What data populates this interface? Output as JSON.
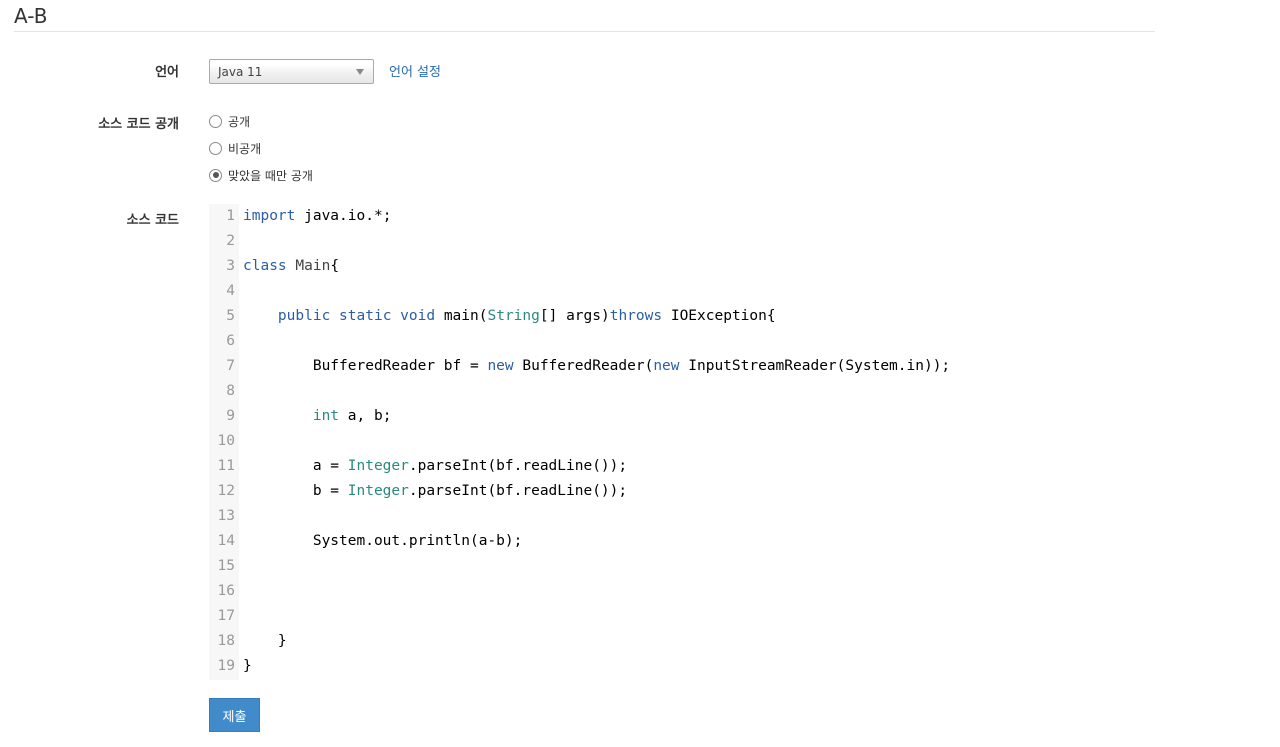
{
  "page": {
    "title": "A-B"
  },
  "language": {
    "label": "언어",
    "selected": "Java 11",
    "settings_link": "언어 설정"
  },
  "visibility": {
    "label": "소스 코드 공개",
    "options": [
      {
        "label": "공개",
        "checked": false
      },
      {
        "label": "비공개",
        "checked": false
      },
      {
        "label": "맞았을 때만 공개",
        "checked": true
      }
    ]
  },
  "source": {
    "label": "소스 코드",
    "lines": [
      [
        {
          "t": "import",
          "c": "kw"
        },
        {
          "t": " java.io.*;"
        }
      ],
      [],
      [
        {
          "t": "class",
          "c": "kw"
        },
        {
          "t": " "
        },
        {
          "t": "Main",
          "c": "def"
        },
        {
          "t": "{"
        }
      ],
      [],
      [
        {
          "t": "    "
        },
        {
          "t": "public",
          "c": "kw"
        },
        {
          "t": " "
        },
        {
          "t": "static",
          "c": "kw"
        },
        {
          "t": " "
        },
        {
          "t": "void",
          "c": "kw"
        },
        {
          "t": " main("
        },
        {
          "t": "String",
          "c": "ty"
        },
        {
          "t": "[] args)"
        },
        {
          "t": "throws",
          "c": "kw"
        },
        {
          "t": " IOException{"
        }
      ],
      [],
      [
        {
          "t": "        BufferedReader bf = "
        },
        {
          "t": "new",
          "c": "kw"
        },
        {
          "t": " BufferedReader("
        },
        {
          "t": "new",
          "c": "kw"
        },
        {
          "t": " InputStreamReader(System.in));"
        }
      ],
      [],
      [
        {
          "t": "        "
        },
        {
          "t": "int",
          "c": "ty"
        },
        {
          "t": " a, b;"
        }
      ],
      [],
      [
        {
          "t": "        a = "
        },
        {
          "t": "Integer",
          "c": "ty"
        },
        {
          "t": ".parseInt(bf.readLine());"
        }
      ],
      [
        {
          "t": "        b = "
        },
        {
          "t": "Integer",
          "c": "ty"
        },
        {
          "t": ".parseInt(bf.readLine());"
        }
      ],
      [],
      [
        {
          "t": "        System.out.println(a-b);"
        }
      ],
      [],
      [],
      [],
      [
        {
          "t": "    }"
        }
      ],
      [
        {
          "t": "}"
        }
      ]
    ]
  },
  "submit": {
    "label": "제출"
  },
  "colors": {
    "accent": "#428bca",
    "link": "#2a6bb0",
    "keyword": "#2b5ea6",
    "type": "#2a8a7e"
  }
}
